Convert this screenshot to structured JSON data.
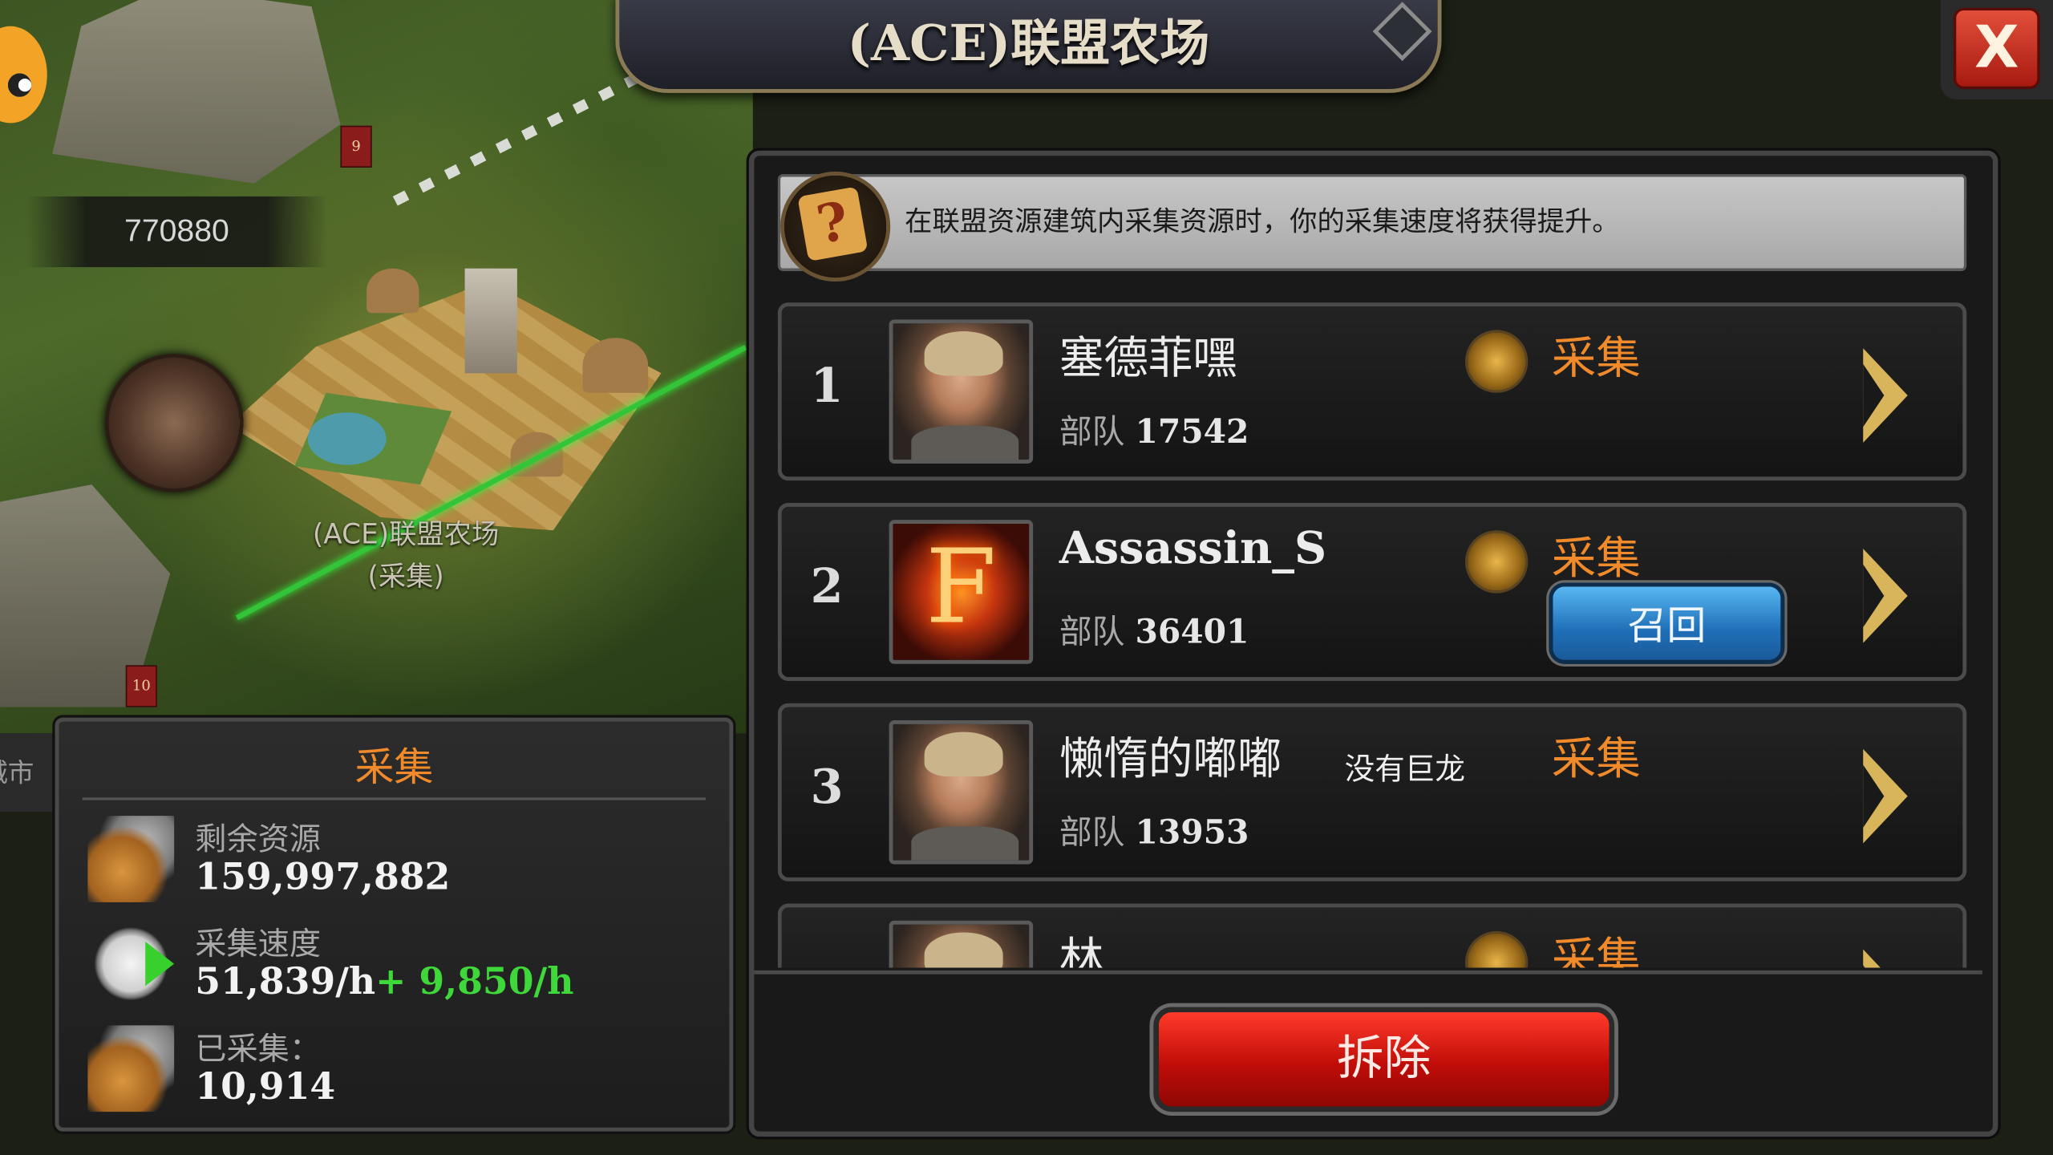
{
  "header": {
    "title": "(ACE)联盟农场",
    "close_label": "X"
  },
  "map": {
    "coordinate": "770880",
    "farm_label": "(ACE)联盟农场",
    "farm_status": "(采集)",
    "flag_1": "9",
    "flag_2": "10",
    "city_edge": "城市"
  },
  "info_panel": {
    "title": "采集",
    "remaining_label": "剩余资源",
    "remaining_value": "159,997,882",
    "speed_label": "采集速度",
    "speed_value": "51,839/h",
    "speed_bonus": "+ 9,850/h",
    "gathered_label": "已采集：",
    "gathered_value": "10,914"
  },
  "notice": {
    "text": "在联盟资源建筑内采集资源时，你的采集速度将获得提升。",
    "icon": "scroll-question-icon"
  },
  "troops_label": "部队",
  "gatherers": [
    {
      "rank": "1",
      "name": "塞德菲嘿",
      "troops": "17542",
      "status": "采集",
      "dragon": "dragon-emblem-icon"
    },
    {
      "rank": "2",
      "name": "Assassin_S",
      "troops": "36401",
      "status": "采集",
      "dragon": "dragon-emblem-icon",
      "action": "召回"
    },
    {
      "rank": "3",
      "name": "懒惰的嘟嘟",
      "troops": "13953",
      "status": "采集",
      "dragon_text": "没有巨龙"
    },
    {
      "rank": "",
      "name": "林",
      "troops": "",
      "status": "采集",
      "dragon": "dragon-emblem-icon"
    }
  ],
  "footer": {
    "demolish_label": "拆除"
  },
  "colors": {
    "accent_orange": "#f08a2a",
    "bonus_green": "#3fd83a",
    "recall_blue": "#1f6fb7",
    "demolish_red": "#c10d08"
  }
}
